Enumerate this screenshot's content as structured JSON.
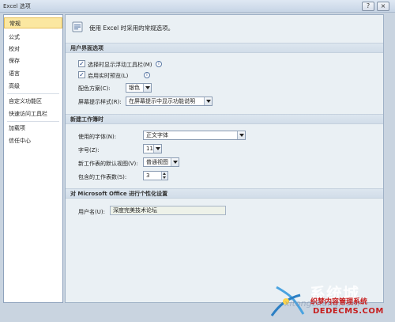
{
  "window": {
    "title": "Excel 选项",
    "help_label": "?",
    "close_label": "×"
  },
  "sidebar": {
    "items": [
      {
        "label": "常规"
      },
      {
        "label": "公式"
      },
      {
        "label": "校对"
      },
      {
        "label": "保存"
      },
      {
        "label": "语言"
      },
      {
        "label": "高级"
      },
      {
        "label": "自定义功能区"
      },
      {
        "label": "快速访问工具栏"
      },
      {
        "label": "加载项"
      },
      {
        "label": "信任中心"
      }
    ]
  },
  "main": {
    "banner_text": "使用 Excel 时采用的常规选项。",
    "ui_section": {
      "title": "用户界面选项",
      "show_minitoolbar_label": "选择时显示浮动工具栏(M)",
      "live_preview_label": "启用实时预览(L)",
      "color_scheme_label": "配色方案(C):",
      "color_scheme_value": "银色",
      "screentip_label": "屏幕提示样式(R):",
      "screentip_value": "在屏幕提示中显示功能说明"
    },
    "new_workbook_section": {
      "title": "新建工作簿时",
      "font_label": "使用的字体(N):",
      "font_value": "正文字体",
      "size_label": "字号(Z):",
      "size_value": "11",
      "view_label": "新工作表的默认视图(V):",
      "view_value": "普通视图",
      "sheets_label": "包含的工作表数(S):",
      "sheets_value": "3"
    },
    "personalize_section": {
      "title": "对 Microsoft Office 进行个性化设置",
      "username_label": "用户名(U):",
      "username_value": "深度完美技术论坛"
    }
  },
  "watermark": {
    "brand": "系统城",
    "site": "xitongcheng.com",
    "line1": "织梦内容管理系统",
    "line2": "DEDECMS.COM"
  },
  "colors": {
    "accent_selected": "#fbe7a1",
    "watermark_red": "#c61e1e"
  }
}
